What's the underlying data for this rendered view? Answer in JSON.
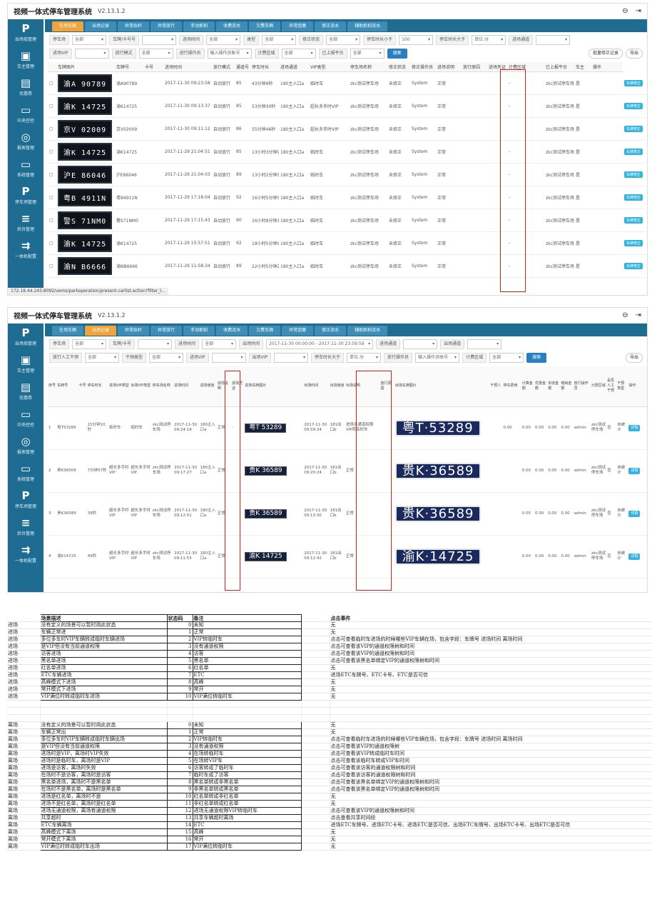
{
  "app": {
    "title": "视频一体式停车管理系统",
    "version": "V2.13.1.2"
  },
  "sidebar": [
    {
      "glyph": "P",
      "label": "出场现管理"
    },
    {
      "glyph": "▣",
      "label": "车主管理"
    },
    {
      "glyph": "▤",
      "label": "优惠券"
    },
    {
      "glyph": "▭",
      "label": "中央控控"
    },
    {
      "glyph": "◎",
      "label": "报表管理"
    },
    {
      "glyph": "▭",
      "label": "系统管理"
    },
    {
      "glyph": "P",
      "label": "停车场管理"
    },
    {
      "glyph": "≡",
      "label": "后台管理"
    },
    {
      "glyph": "⇉",
      "label": "一体机配置"
    }
  ],
  "tabs": [
    "在场车辆",
    "出场记录",
    "异常抬杆",
    "异常放行",
    "手动抓拍",
    "收费流水",
    "欠费车辆",
    "异常追缴",
    "修正流水",
    "辅助抓拍流水"
  ],
  "screen1": {
    "filter1": [
      {
        "label": "停车场",
        "value": "全部"
      },
      {
        "label": "车牌/卡号号",
        "value": ""
      },
      {
        "label": "进场时间",
        "value": "全部"
      },
      {
        "label": "类型",
        "value": "全部"
      },
      {
        "label": "修正状态",
        "value": "全部"
      },
      {
        "label": "停车时长小于",
        "value": "100"
      },
      {
        "label": "停车时长大于",
        "value": "单位:分"
      },
      {
        "label": "进场通道",
        "value": ""
      }
    ],
    "filter2": [
      {
        "label": "进场VIP",
        "value": ""
      },
      {
        "label": "放行模式",
        "value": "全部"
      },
      {
        "label": "进行操作员",
        "value": "输入操作员账号"
      },
      {
        "label": "计费区域",
        "value": "全部"
      },
      {
        "label": "已上报平台",
        "value": "全部"
      }
    ],
    "search": "搜索",
    "batch": "批量修正记录",
    "export": "导出",
    "columns": [
      "",
      "车牌图片",
      "车牌号",
      "卡号",
      "进场时间",
      "放行模式",
      "通道号",
      "停车时长",
      "进场通道",
      "VIP类型",
      "停车场名称",
      "修正状态",
      "修正操作员",
      "进场说明",
      "放行原因",
      "进场凭证",
      "计费区域",
      "已上报平台",
      "车主",
      "操作"
    ],
    "rows": [
      {
        "plate_img": "渝A 90789",
        "plate": "渝A90789",
        "time": "2017-11-30 09:23:58",
        "mode": "自动放行",
        "lane": "85",
        "dur": "43分钟9秒",
        "gate": "180主入口a",
        "vip": "临时车",
        "park": "zkc测试停车场",
        "fix": "未修正",
        "op": "System",
        "desc": "正常",
        "voucher": "-",
        "area": "zkc测试停车场",
        "rep": "是",
        "act": "车牌修正"
      },
      {
        "plate_img": "渝K 14725",
        "plate": "渝K14725",
        "time": "2017-11-30 09:13:37",
        "mode": "自动放行",
        "lane": "85",
        "dur": "53分钟30秒",
        "gate": "180主入口a",
        "vip": "超长多手时VIP",
        "park": "zkc测试停车场",
        "fix": "未修正",
        "op": "System",
        "desc": "正常",
        "voucher": "-",
        "area": "zkc测试停车场",
        "rep": "是",
        "act": "车牌修正"
      },
      {
        "plate_img": "京V 02009",
        "plate": "京V02009",
        "time": "2017-11-30 09:11:12",
        "mode": "自动放行",
        "lane": "86",
        "dur": "55分钟46秒",
        "gate": "180主入口a",
        "vip": "超长多手时VIP",
        "park": "zkc测试停车场",
        "fix": "未修正",
        "op": "System",
        "desc": "正常",
        "voucher": "",
        "area": "zkc测试停车场",
        "rep": "是",
        "act": "车牌修正"
      },
      {
        "plate_img": "渝K 14725",
        "plate": "渝K14725",
        "time": "2017-11-29 21:04:51",
        "mode": "自动放行",
        "lane": "85",
        "dur": "13小时3分钟9秒",
        "gate": "180主入口a",
        "vip": "临时车",
        "park": "zkc测试停车场",
        "fix": "未修正",
        "op": "System",
        "desc": "正常",
        "voucher": "-",
        "area": "zkc测试停车场",
        "rep": "是",
        "act": "车牌修正"
      },
      {
        "plate_img": "沪E 86046",
        "plate": "沪E86046",
        "time": "2017-11-29 21:04:03",
        "mode": "自动放行",
        "lane": "89",
        "dur": "13小时2分钟57秒",
        "gate": "180主入口a",
        "vip": "临时车",
        "park": "zkc测试停车场",
        "fix": "未修正",
        "op": "System",
        "desc": "正常",
        "voucher": "-",
        "area": "zkc测试停车场",
        "rep": "是",
        "act": "车牌修正"
      },
      {
        "plate_img": "粤B 4911N",
        "plate": "粤B4911N",
        "time": "2017-11-29 17:18:04",
        "mode": "自动放行",
        "lane": "92",
        "dur": "16小时5分钟54秒",
        "gate": "180主入口a",
        "vip": "临时车",
        "park": "zkc测试停车场",
        "fix": "未修正",
        "op": "System",
        "desc": "正常",
        "voucher": "-",
        "area": "zkc测试停车场",
        "rep": "是",
        "act": "车牌修正"
      },
      {
        "plate_img": "警S 71NM0",
        "plate": "警S71NM0",
        "time": "2017-11-29 17:15:43",
        "mode": "自动放行",
        "lane": "90",
        "dur": "16小时8分钟17秒",
        "gate": "180主入口a",
        "vip": "临时车",
        "park": "zkc测试停车场",
        "fix": "未修正",
        "op": "System",
        "desc": "正常",
        "voucher": "-",
        "area": "zkc测试停车场",
        "rep": "是",
        "act": "车牌修正"
      },
      {
        "plate_img": "渝K 14725",
        "plate": "渝K14725",
        "time": "2017-11-29 15:57:51",
        "mode": "自动放行",
        "lane": "92",
        "dur": "18小时5分钟9秒",
        "gate": "180主入口a",
        "vip": "临时车",
        "park": "zkc测试停车场",
        "fix": "未修正",
        "op": "System",
        "desc": "正常",
        "voucher": "-",
        "area": "zkc测试停车场",
        "rep": "是",
        "act": "车牌修正"
      },
      {
        "plate_img": "渝N B6666",
        "plate": "渝NB6666",
        "time": "2017-11-29 11:58:34",
        "mode": "自动放行",
        "lane": "89",
        "dur": "22小时5分钟24秒",
        "gate": "180主入口a",
        "vip": "临时车",
        "park": "zkc测试停车场",
        "fix": "未修正",
        "op": "System",
        "desc": "正常",
        "voucher": "-",
        "area": "zkc测试停车场",
        "rep": "是",
        "act": "车牌修正"
      }
    ],
    "url": "172.18.44.245:8092/vems/parkoperation/present-carlist.action?filter_l..."
  },
  "screen2": {
    "filter1": [
      {
        "label": "停车场",
        "value": "全部"
      },
      {
        "label": "车牌/卡号",
        "value": ""
      },
      {
        "label": "进场时间",
        "value": "全部"
      },
      {
        "label": "出场时间",
        "value": "2017-11-30 00:00:00 - 2017-11-30 23:59:59"
      },
      {
        "label": "进场通道",
        "value": ""
      },
      {
        "label": "出场通道",
        "value": ""
      }
    ],
    "filter2": [
      {
        "label": "放行人工干预",
        "value": "全部"
      },
      {
        "label": "干预类型",
        "value": "全部"
      },
      {
        "label": "进场VIP",
        "value": ""
      },
      {
        "label": "出场VIP",
        "value": ""
      },
      {
        "label": "停车时长大于",
        "value": "单位:分"
      },
      {
        "label": "放行操作员",
        "value": "输入操作员账号"
      },
      {
        "label": "计费区域",
        "value": "全部"
      }
    ],
    "search": "搜索",
    "export": "导出",
    "columns": [
      "序号",
      "车牌号",
      "卡号",
      "停车时长",
      "进场VIP类型",
      "出场VIP类型",
      "停车场名称",
      "进场时间",
      "进场通道",
      "进场说明",
      "进场凭证",
      "进场车牌图片",
      "出场时间",
      "出场通道",
      "出场说明",
      "放行原因",
      "出场车牌图片",
      "干预人",
      "停车费用",
      "计算金额",
      "优惠金额",
      "实收金额",
      "缴纳金额",
      "放行操作员",
      "计费区域",
      "是否人工干预",
      "干预类型",
      "操作"
    ],
    "rows": [
      {
        "no": "1",
        "plate": "粤T53289",
        "dur": "15分钟10秒",
        "vin": "临时车",
        "vout": "临时车",
        "park": "zkc测试停车场",
        "tin": "2017-11-30 09:24:14",
        "gin": "180主入口a",
        "din": "正常",
        "vch": "-",
        "pin": "粤T 53289",
        "tout": "2017-11-30 09:59:24",
        "gout": "181出口b",
        "dout": "进场无通道权限VIP转临时车",
        "pout": "粤T·53289",
        "fee": "0.00",
        "calc": "0.00",
        "disc": "0.00",
        "paid": "0.00",
        "pay": "0.00",
        "op": "admin",
        "area": "zkc测试停车场",
        "iv": "否",
        "ivt": "未统计",
        "act": "详情"
      },
      {
        "no": "2",
        "plate": "贵K36509",
        "dur": "7分钟57秒",
        "vin": "超长多手时VIP",
        "vout": "超长多手时VIP",
        "park": "zkc测试停车场",
        "tin": "2017-11-30 09:17:27",
        "gin": "180主入口a",
        "din": "正常",
        "vch": "",
        "pin": "贵K 36589",
        "tout": "2017-11-30 09:20:24",
        "gout": "181出口b",
        "dout": "正常",
        "pout": "贵K·36589",
        "fee": "",
        "calc": "0.00",
        "disc": "0.00",
        "paid": "0.00",
        "pay": "0.00",
        "op": "admin",
        "area": "zkc测试停车场",
        "iv": "否",
        "ivt": "未统计",
        "act": "详情"
      },
      {
        "no": "3",
        "plate": "贵K36589",
        "dur": "39秒",
        "vin": "超长多手时VIP",
        "vout": "超长多手时VIP",
        "park": "zkc测试停车场",
        "tin": "2017-11-30 09:12:51",
        "gin": "180主入口a",
        "din": "正常",
        "vch": "",
        "pin": "贵K 36589",
        "tout": "2017-11-30 09:13:30",
        "gout": "181出口b",
        "dout": "正常",
        "pout": "贵K·36589",
        "fee": "",
        "calc": "0.00",
        "disc": "0.00",
        "paid": "0.00",
        "pay": "0.00",
        "op": "admin",
        "area": "zkc测试停车场",
        "iv": "否",
        "ivt": "未统计",
        "act": "详情"
      },
      {
        "no": "4",
        "plate": "渝K14725",
        "dur": "49秒",
        "vin": "超长多手时VIP",
        "vout": "超长多手时VIP",
        "park": "zkc测试停车场",
        "tin": "2017-11-30 09:11:53",
        "gin": "180主入口a",
        "din": "正常",
        "vch": "",
        "pin": "渝K 14725",
        "tout": "2017-11-30 09:12:42",
        "gout": "181出口b",
        "dout": "正常",
        "pout": "渝K·14725",
        "fee": "",
        "calc": "0.00",
        "disc": "0.00",
        "paid": "0.00",
        "pay": "0.00",
        "op": "admin",
        "area": "zkc测试停车场",
        "iv": "否",
        "ivt": "未统计",
        "act": "详情"
      }
    ]
  },
  "sheet": {
    "header": [
      "",
      "场景描述",
      "状态码",
      "备注",
      "",
      "点击事件"
    ],
    "entry": [
      [
        "进场",
        "没有定义的场景可以暂时用此状态",
        "0",
        "未知",
        "无"
      ],
      [
        "进场",
        "车辆正常进",
        "1",
        "正常",
        "无"
      ],
      [
        "进场",
        "多位多车时VIP车辆转成临时车辆进场",
        "2",
        "VIP转临时车",
        "点击可查看临时车进场的时候哪些VIP车辆在场，包含字段：车牌号  进场时间  离场时间"
      ],
      [
        "进场",
        "是VIP但没有当前通道权限",
        "3",
        "没有通道权限",
        "点击可查看该VIP的通道权限树和时间"
      ],
      [
        "进场",
        "访客进场",
        "4",
        "访客",
        "点击可查看该VIP的通道权限树和时间"
      ],
      [
        "进场",
        "黑名单进场",
        "5",
        "黑名单",
        "点击可查看该黑名单绑定VIP的通道权限树和时间"
      ],
      [
        "进场",
        "红名单进场",
        "6",
        "红名单",
        "无"
      ],
      [
        "进场",
        "ETC车辆进场",
        "7",
        "ETC",
        "进场ETC车牌号、ETC卡号、ETC是否可信"
      ],
      [
        "进场",
        "高峰模式下进场",
        "8",
        "高峰",
        "无"
      ],
      [
        "进场",
        "常开模式下进场",
        "9",
        "常开",
        "无"
      ],
      [
        "进场",
        "VIP满位时转成临时车进场",
        "10",
        "VIP满位转临时车",
        "无"
      ]
    ],
    "exit": [
      [
        "离场",
        "没有定义的场景可以暂时用此状态",
        "0",
        "未知",
        "无"
      ],
      [
        "离场",
        "车辆正常出",
        "1",
        "正常",
        "无"
      ],
      [
        "离场",
        "多位多车时VIP车辆转成临时车辆出场",
        "2",
        "VIP转临时车",
        "点击可查看临时车进场的时候哪些VIP车辆在场，包含字段：车牌号  进场时间  离场时间"
      ],
      [
        "离场",
        "是VIP但没有当前通道权限",
        "3",
        "没有通道权限",
        "点击可查看该VIP的通道权限树"
      ],
      [
        "离场",
        "进场时是VIP，离场时VIP失效",
        "4",
        "在场转临时车",
        "点击可查看该VIP转成临时车时间"
      ],
      [
        "离场",
        "进场时是临时车，离场时是VIP",
        "5",
        "在场转VIP车",
        "点击可查看该临时车转成VIP车时间"
      ],
      [
        "离场",
        "进场是访客，离场时失效",
        "6",
        "访客转成了临时车",
        "点击可查看该访客的通道权限树和时间"
      ],
      [
        "离场",
        "在场时不是访客，离场时是访客",
        "7",
        "临时车成了访客",
        "点击可查看该访客的通道权限树和时间"
      ],
      [
        "离场",
        "黑名单进场，离场时不是黑名单",
        "8",
        "黑名单转成非黑名单",
        "点击可查看该黑名单绑定VIP的通道权限树和时间"
      ],
      [
        "离场",
        "在场时不是黑名单，离场时是黑名单",
        "9",
        "非黑名单转成黑名单",
        "点击可查看该黑名单绑定VIP的通道权限树和时间"
      ],
      [
        "离场",
        "进场是红名单，离场时不是",
        "10",
        "红名单转成非红名单",
        "无"
      ],
      [
        "离场",
        "进场不是红名单，离场时是红名单",
        "11",
        "非红名单转成红名单",
        "无"
      ],
      [
        "离场",
        "进场无通道权限，离场有通道权限",
        "12",
        "进场无通道权限VIP转临时车",
        "点击可查看该VIP的通道权限树和时间"
      ],
      [
        "离场",
        "共享超时",
        "13",
        "共享车辆超时离场",
        "点击查看共享时间段"
      ],
      [
        "离场",
        "ETC车辆离场",
        "14",
        "ETC",
        "进场ETC车牌号、进场ETC卡号、进场ETC是否可信、出场ETC车牌号、出场ETC卡号、出场ETC是否可信"
      ],
      [
        "离场",
        "高峰模式下离场",
        "15",
        "高峰",
        "无"
      ],
      [
        "离场",
        "常开模式下离场",
        "16",
        "常开",
        "无"
      ],
      [
        "离场",
        "VIP满位时转成临时车出场",
        "17",
        "VIP满位转临时车",
        "无"
      ]
    ]
  }
}
